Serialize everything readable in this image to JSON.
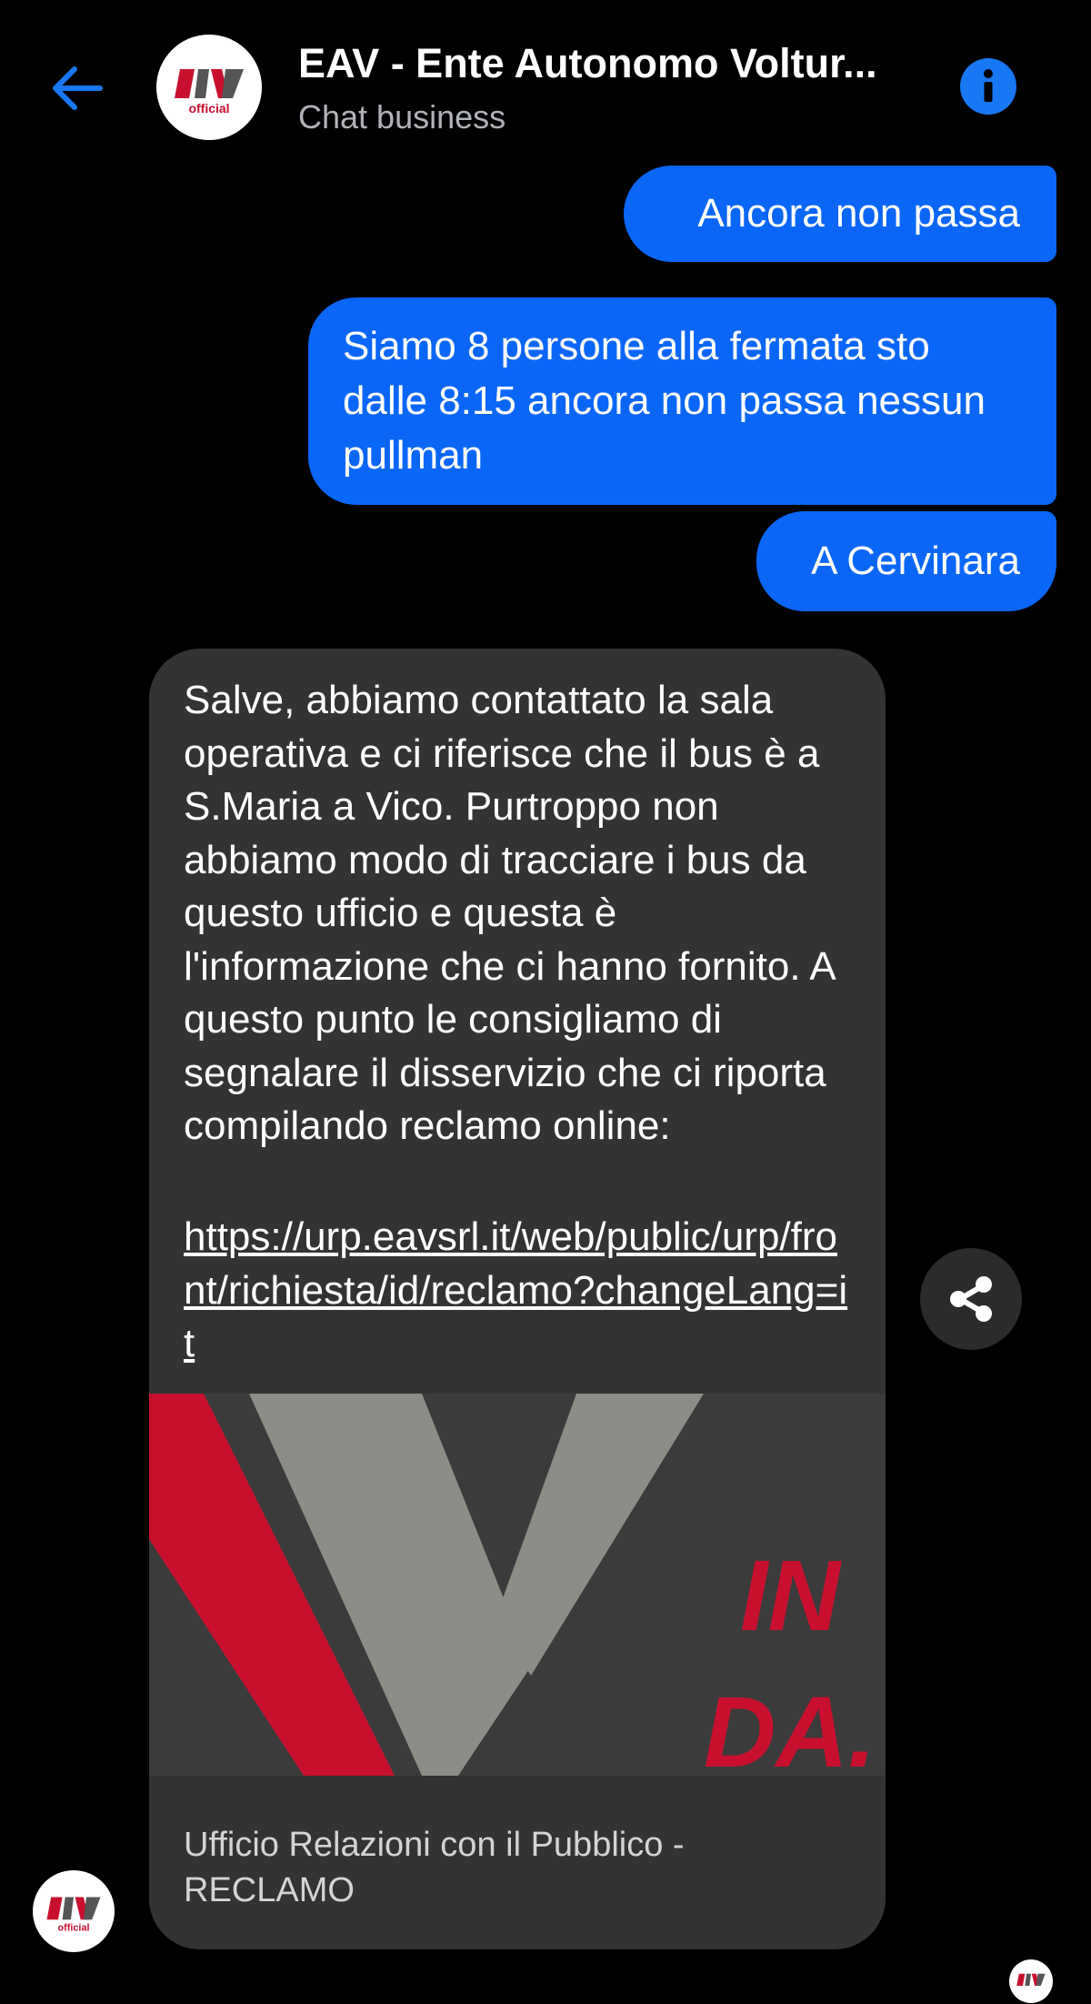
{
  "header": {
    "title": "EAV - Ente Autonomo Voltur...",
    "subtitle": "Chat business",
    "logo_text": "EAV",
    "logo_sub": "official"
  },
  "messages": {
    "outgoing": [
      "Ancora non passa",
      "Siamo 8 persone alla fermata sto dalle 8:15 ancora non passa nessun pullman",
      "A Cervinara"
    ],
    "incoming": {
      "text": "Salve, abbiamo contattato la sala operativa e ci riferisce che il bus è a S.Maria a Vico. Purtroppo non abbiamo modo di tracciare i bus da questo ufficio e questa è l'informazione che ci hanno fornito. A questo punto le consigliamo di segnalare il disservizio che ci riporta compilando reclamo online:",
      "link": "https://urp.eavsrl.it/web/public/urp/front/richiesta/id/reclamo?changeLang=it",
      "preview_overlay_line1": "IN",
      "preview_overlay_line2": "DA.",
      "preview_title": "Ufficio Relazioni con il Pubblico - RECLAMO"
    }
  },
  "icons": {
    "back": "arrow-left-icon",
    "info": "info-icon",
    "share": "share-icon"
  },
  "colors": {
    "accent": "#0a66f7",
    "info": "#1877f2",
    "background": "#000000",
    "incoming_bubble": "#333334",
    "brand_red": "#c8102e",
    "brand_grey": "#8d8d87"
  }
}
